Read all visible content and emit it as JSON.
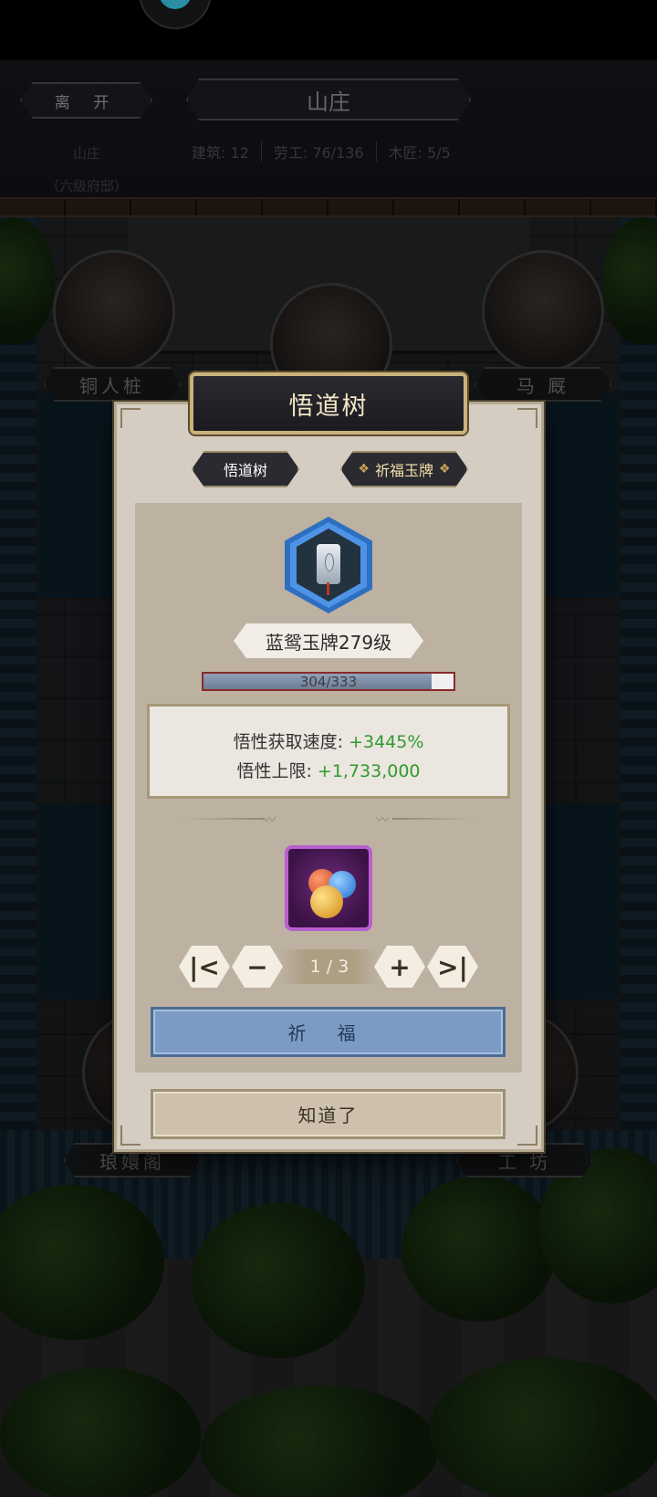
{
  "header": {
    "leave_label": "离 开",
    "title": "山庄",
    "location_name": "山庄",
    "location_rank": "（六级府邸）",
    "stats": [
      "建筑: 12",
      "劳工: 76/136",
      "木匠: 5/5"
    ]
  },
  "buildings": {
    "top_left": "铜人桩",
    "top_right": "马 厩",
    "bottom_left": "琅嬛阁",
    "bottom_right": "工 坊"
  },
  "dialog": {
    "title": "悟道树",
    "tabs": [
      "悟道树",
      "祈福玉牌"
    ],
    "item_level": "蓝鸳玉牌279级",
    "progress": {
      "current": 304,
      "max": 333,
      "text": "304/333"
    },
    "stats": [
      {
        "label": "悟性获取速度: ",
        "value": "+3445%"
      },
      {
        "label": "悟性上限: ",
        "value": "+1,733,000"
      }
    ],
    "pager": {
      "first": "|<",
      "minus": "−",
      "text": "1 / 3",
      "plus": "+",
      "last": ">|"
    },
    "pray_label": "祈 福",
    "ok_label": "知道了"
  },
  "colors": {
    "accent_blue": "#7b9bc4",
    "stat_green": "#2f9a2f",
    "badge_blue": "#2d6fc0",
    "item_purple": "#b95fcf"
  },
  "icons": [
    "mascot-icon",
    "jade-tablet-icon",
    "orbs-icon",
    "first-page-icon",
    "minus-icon",
    "plus-icon",
    "last-page-icon"
  ]
}
